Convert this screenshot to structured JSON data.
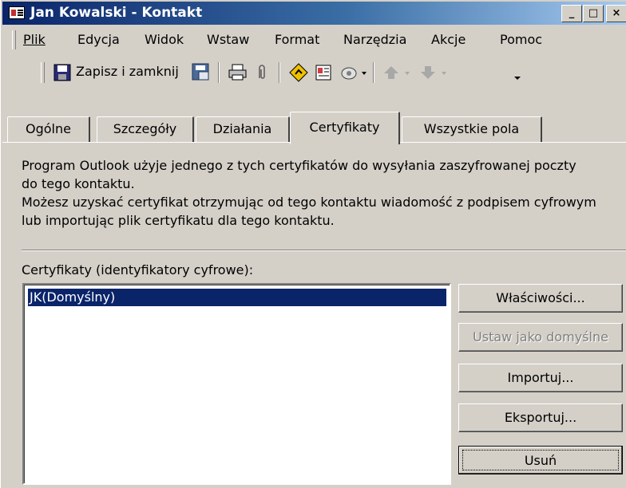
{
  "window": {
    "title": "Jan Kowalski - Kontakt",
    "controls": {
      "minimize": "_",
      "maximize": "□",
      "close": "×"
    }
  },
  "menubar": {
    "items": [
      "Plik",
      "Edycja",
      "Widok",
      "Wstaw",
      "Format",
      "Narzędzia",
      "Akcje",
      "Pomoc"
    ]
  },
  "toolbar": {
    "save_close_label": "Zapisz i zamknij",
    "icons": [
      "save-icon",
      "save-as-contact-icon",
      "print-icon",
      "attach-icon",
      "follow-up-flag-icon",
      "new-contact-icon",
      "phone-dial-icon",
      "previous-item-icon",
      "next-item-icon",
      "toolbar-options-icon"
    ]
  },
  "tabs": {
    "items": [
      "Ogólne",
      "Szczegóły",
      "Działania",
      "Certyfikaty",
      "Wszystkie pola"
    ],
    "active": "Certyfikaty"
  },
  "certificates_page": {
    "info_line1": "Program Outlook użyje jednego z tych certyfikatów do wysyłania zaszyfrowanej poczty",
    "info_line2": "do tego kontaktu.",
    "info_line3": "Możesz uzyskać certyfikat otrzymując od tego kontaktu wiadomość z podpisem cyfrowym",
    "info_line4": "lub importując plik certyfikatu dla tego kontaktu.",
    "list_label": "Certyfikaty (identyfikatory cyfrowe):",
    "certificates": [
      "JK(Domyślny)"
    ],
    "selected_certificate": "JK(Domyślny)",
    "buttons": {
      "properties": "Właściwości...",
      "set_default": "Ustaw jako domyślne",
      "import": "Importuj...",
      "export": "Eksportuj...",
      "remove": "Usuń"
    }
  },
  "colors": {
    "titlebar_start": "#0a246a",
    "titlebar_end": "#a6caf0",
    "face": "#d4d0c8",
    "selection": "#0a246a"
  }
}
